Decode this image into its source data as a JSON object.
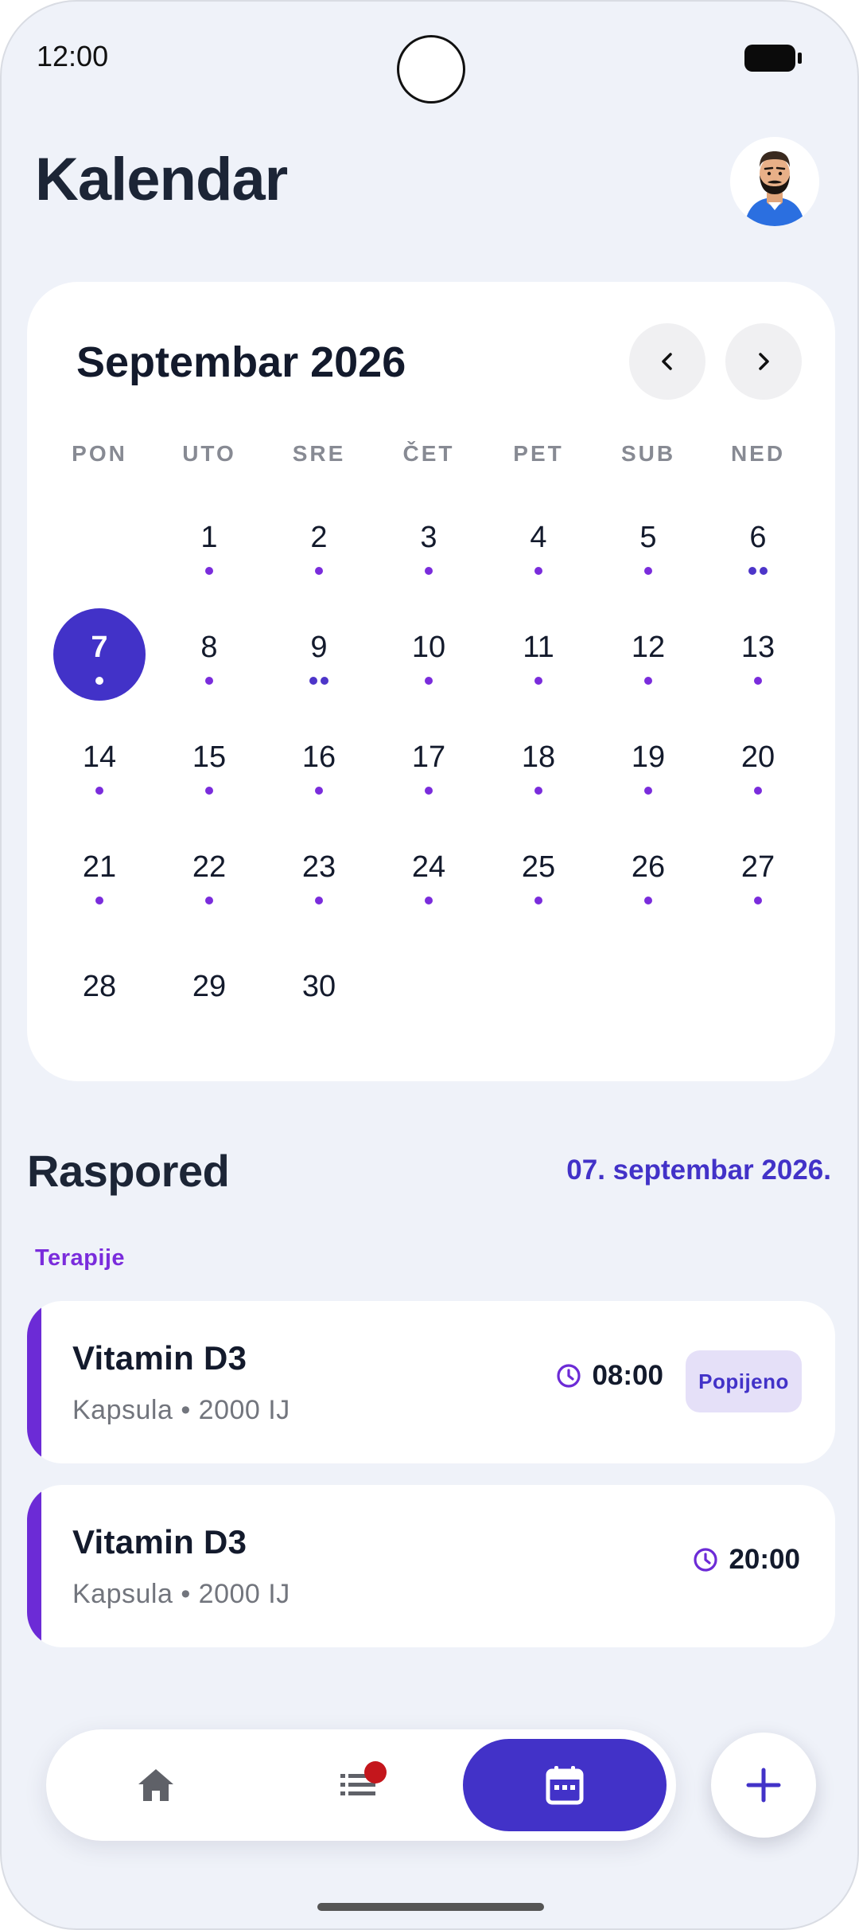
{
  "status_bar": {
    "time": "12:00"
  },
  "header": {
    "title": "Kalendar",
    "avatar_icon": "bearded-man-avatar"
  },
  "calendar": {
    "month_label": "Septembar 2026",
    "prev_icon": "chevron-left-icon",
    "next_icon": "chevron-right-icon",
    "weekdays": [
      "PON",
      "UTO",
      "SRE",
      "ČET",
      "PET",
      "SUB",
      "NED"
    ],
    "selected_day": "7",
    "weeks": [
      [
        {
          "day": "",
          "dots": 0
        },
        {
          "day": "1",
          "dots": 1
        },
        {
          "day": "2",
          "dots": 1
        },
        {
          "day": "3",
          "dots": 1
        },
        {
          "day": "4",
          "dots": 1
        },
        {
          "day": "5",
          "dots": 1
        },
        {
          "day": "6",
          "dots": 2
        }
      ],
      [
        {
          "day": "7",
          "dots": 1
        },
        {
          "day": "8",
          "dots": 1
        },
        {
          "day": "9",
          "dots": 2
        },
        {
          "day": "10",
          "dots": 1
        },
        {
          "day": "11",
          "dots": 1
        },
        {
          "day": "12",
          "dots": 1
        },
        {
          "day": "13",
          "dots": 1
        }
      ],
      [
        {
          "day": "14",
          "dots": 1
        },
        {
          "day": "15",
          "dots": 1
        },
        {
          "day": "16",
          "dots": 1
        },
        {
          "day": "17",
          "dots": 1
        },
        {
          "day": "18",
          "dots": 1
        },
        {
          "day": "19",
          "dots": 1
        },
        {
          "day": "20",
          "dots": 1
        }
      ],
      [
        {
          "day": "21",
          "dots": 1
        },
        {
          "day": "22",
          "dots": 1
        },
        {
          "day": "23",
          "dots": 1
        },
        {
          "day": "24",
          "dots": 1
        },
        {
          "day": "25",
          "dots": 1
        },
        {
          "day": "26",
          "dots": 1
        },
        {
          "day": "27",
          "dots": 1
        }
      ],
      [
        {
          "day": "28",
          "dots": 0
        },
        {
          "day": "29",
          "dots": 0
        },
        {
          "day": "30",
          "dots": 0
        }
      ]
    ]
  },
  "schedule": {
    "title": "Raspored",
    "date": "07. septembar 2026.",
    "section_label": "Terapije",
    "items": [
      {
        "name": "Vitamin D3",
        "detail": "Kapsula • 2000 IJ",
        "time": "08:00",
        "status": "Popijeno"
      },
      {
        "name": "Vitamin D3",
        "detail": "Kapsula • 2000 IJ",
        "time": "20:00",
        "status": ""
      }
    ]
  },
  "bottom_nav": {
    "items": [
      {
        "icon": "home-icon",
        "active": false
      },
      {
        "icon": "list-icon",
        "active": false,
        "badge": true
      },
      {
        "icon": "calendar-icon",
        "active": true
      }
    ],
    "fab_icon": "plus-icon"
  },
  "colors": {
    "accent": "#4232c8",
    "purple": "#7a2cdc",
    "background": "#eff2f9",
    "title": "#1c2536",
    "notification": "#c4161c"
  }
}
